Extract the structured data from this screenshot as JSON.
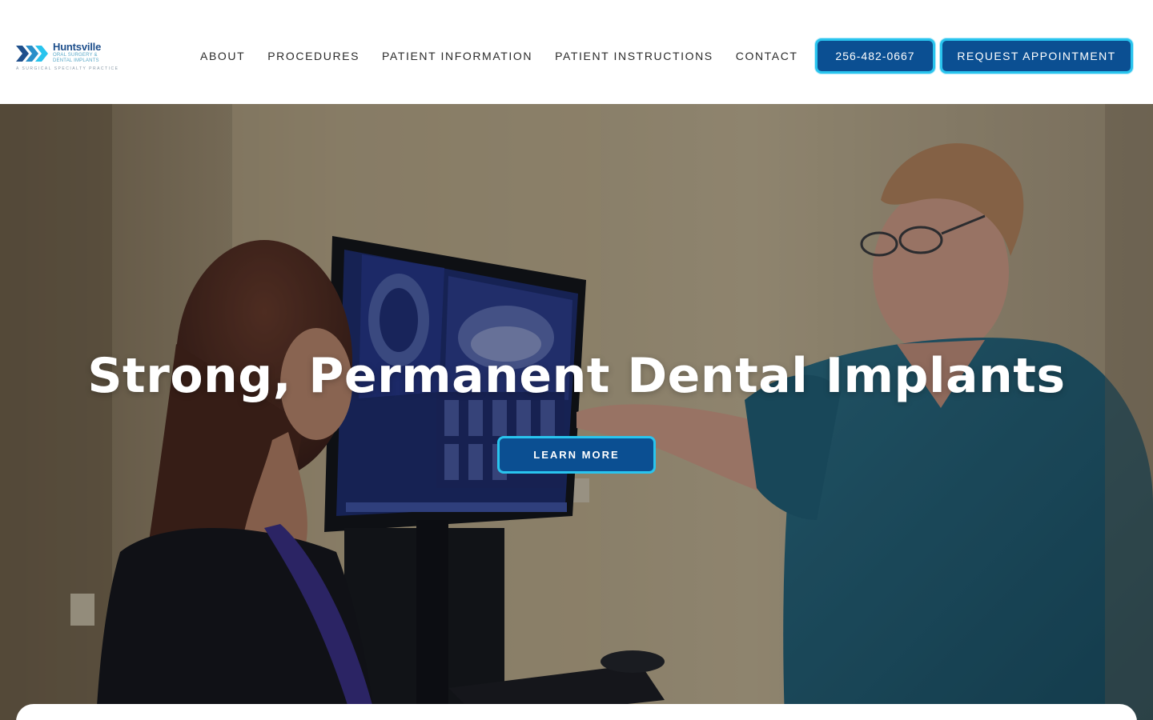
{
  "brand": {
    "name": "Huntsville",
    "subtitle_line1": "Oral Surgery &",
    "subtitle_line2": "Dental Implants",
    "tagline": "A Surgical Specialty Practice"
  },
  "nav": {
    "items": [
      {
        "label": "About"
      },
      {
        "label": "Procedures"
      },
      {
        "label": "Patient Information"
      },
      {
        "label": "Patient Instructions"
      },
      {
        "label": "Contact"
      }
    ]
  },
  "cta": {
    "phone_label": "256-482-0667",
    "appointment_label": "Request Appointment"
  },
  "hero": {
    "title": "Strong, Permanent Dental Implants",
    "button_label": "Learn More"
  },
  "colors": {
    "accent": "#0b4f92",
    "accent_border": "#29c4ee",
    "logo_blue": "#1e4f8c",
    "logo_cyan": "#29c4ee"
  },
  "icons": {
    "logo_mark": "triple-chevron-icon"
  }
}
